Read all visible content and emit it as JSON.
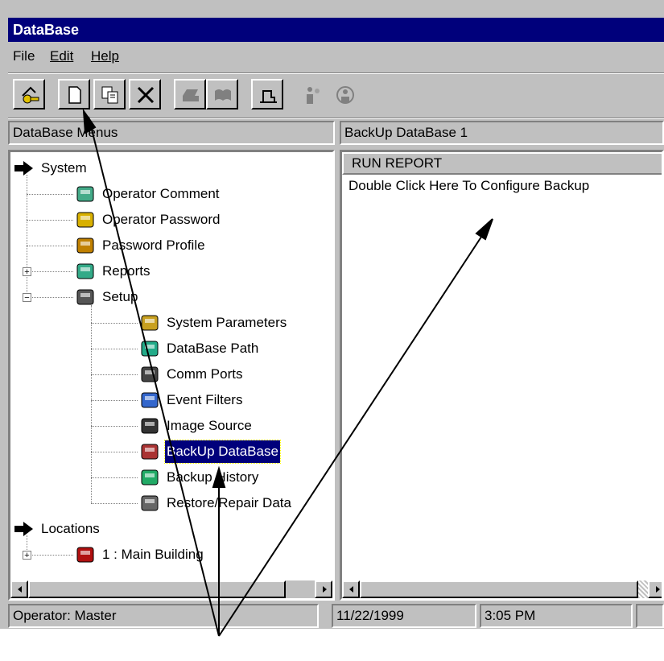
{
  "window": {
    "title": "DataBase"
  },
  "menu": [
    {
      "label": "File"
    },
    {
      "label": "Edit"
    },
    {
      "label": "Help"
    }
  ],
  "toolbar": {
    "buttons": [
      {
        "name": "operator-key-icon"
      },
      {
        "name": "new-document-icon"
      },
      {
        "name": "copy-icon"
      },
      {
        "name": "delete-icon"
      },
      {
        "name": "print-icon"
      },
      {
        "name": "preview-icon"
      },
      {
        "name": "chart-icon"
      },
      {
        "name": "people-icon"
      },
      {
        "name": "help-people-icon"
      }
    ]
  },
  "left_pane": {
    "header": "DataBase Menus",
    "tree": [
      {
        "label": "System",
        "icon": "arrow-right-icon"
      },
      {
        "label": "Operator Comment",
        "icon": "comment-icon"
      },
      {
        "label": "Operator Password",
        "icon": "key-icon"
      },
      {
        "label": "Password Profile",
        "icon": "profile-icon"
      },
      {
        "label": "Reports",
        "icon": "reports-icon"
      },
      {
        "label": "Setup",
        "icon": "computer-icon"
      },
      {
        "label": "System Parameters",
        "icon": "parameters-icon"
      },
      {
        "label": "DataBase Path",
        "icon": "path-icon"
      },
      {
        "label": "Comm Ports",
        "icon": "comm-icon"
      },
      {
        "label": "Event Filters",
        "icon": "filter-icon"
      },
      {
        "label": "Image Source",
        "icon": "camera-icon"
      },
      {
        "label": "BackUp DataBase",
        "icon": "backup-icon"
      },
      {
        "label": "Backup History",
        "icon": "history-icon"
      },
      {
        "label": "Restore/Repair Data",
        "icon": "wrench-icon"
      },
      {
        "label": "Locations",
        "icon": "arrow-right-icon"
      },
      {
        "label": "1 : Main Building",
        "icon": "building-icon"
      }
    ]
  },
  "right_pane": {
    "header": "BackUp DataBase  1",
    "column": "RUN REPORT",
    "row": "Double Click Here To Configure Backup"
  },
  "status": {
    "operator": "Operator:  Master",
    "date": "11/22/1999",
    "time": "3:05 PM"
  }
}
